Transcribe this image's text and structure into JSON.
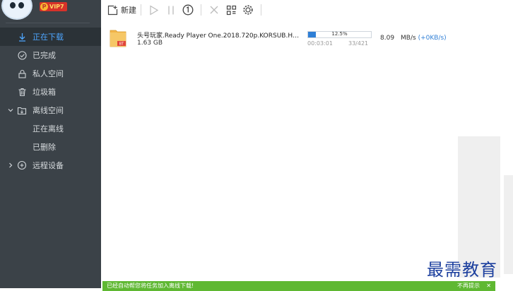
{
  "sidebar": {
    "vip_badge": "VIP7",
    "items": [
      {
        "label": "正在下载",
        "icon": "download-icon"
      },
      {
        "label": "已完成",
        "icon": "check-circle-icon"
      },
      {
        "label": "私人空间",
        "icon": "lock-icon"
      },
      {
        "label": "垃圾箱",
        "icon": "trash-icon"
      },
      {
        "label": "离线空间",
        "icon": "cloud-folder-icon"
      },
      {
        "label": "正在离线"
      },
      {
        "label": "已删除"
      },
      {
        "label": "远程设备",
        "icon": "remote-device-icon"
      }
    ]
  },
  "toolbar": {
    "new_label": "新建",
    "icons": [
      "new-task-icon",
      "play-icon",
      "pause-icon",
      "speed-limit-icon",
      "delete-icon",
      "grid-icon",
      "settings-gear-icon"
    ]
  },
  "task": {
    "name": "头号玩家.Ready Player One.2018.720p.KORSUB.HDRip...",
    "size": "1.63 GB",
    "progress_pct": "12.5%",
    "progress": 0.125,
    "elapsed": "00:03:01",
    "pieces": "33/421",
    "speed_value": "8.09",
    "speed_unit": "MB/s",
    "upload_speed": "(+0KB/s)",
    "file_type": "BT"
  },
  "bottombar": {
    "message": "已经自动帮您将任务加入离线下载!",
    "option": "不再提示",
    "close": "✕"
  },
  "watermark": "最需教育",
  "colors": {
    "sidebar_bg": "#3b4248",
    "active_item_bg": "#2b3237",
    "accent": "#4ea6ff",
    "progress_fill": "#2f7fd6",
    "bottombar_bg": "#5fb832",
    "watermark": "#1c3f9e"
  }
}
